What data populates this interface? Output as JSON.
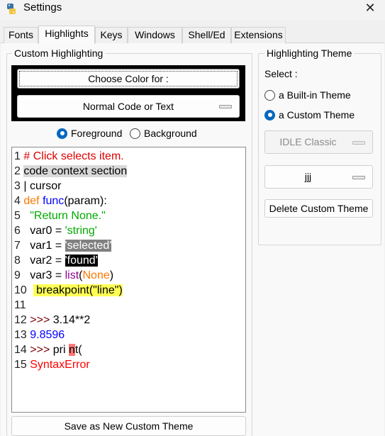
{
  "window": {
    "title": "Settings",
    "close_glyph": "✕"
  },
  "tabs": [
    {
      "label": "Fonts",
      "active": false
    },
    {
      "label": "Highlights",
      "active": true
    },
    {
      "label": "Keys",
      "active": false
    },
    {
      "label": "Windows",
      "active": false
    },
    {
      "label": "Shell/Ed",
      "active": false
    },
    {
      "label": "Extensions",
      "active": false
    }
  ],
  "custom": {
    "group_label": "Custom Highlighting",
    "choose_color_label": "Choose Color for :",
    "element_label": "Normal Code or Text",
    "foreground_label": "Foreground",
    "background_label": "Background",
    "target": "foreground",
    "save_label": "Save as New Custom Theme"
  },
  "sample": {
    "line_numbers": [
      "1",
      "2",
      "3",
      "4",
      "5",
      "6",
      "7",
      "8",
      "9",
      "10",
      "11",
      "12",
      "13",
      "14",
      "15"
    ],
    "comment": "# Click selects item.",
    "context": "code context section",
    "cursor_bar": "|",
    "cursor_text": " cursor",
    "kw_def": "def",
    "func_name": "func",
    "param": "(param):",
    "docstring": "\"Return None.\"",
    "var0": "var0 = ",
    "str_string": "'string'",
    "var1": "var1 = ",
    "str_selected": "'selected'",
    "var2": "var2 = ",
    "str_found": "'found'",
    "var3": "var3 = ",
    "builtin_list": "list",
    "paren_open": "(",
    "kw_none": "None",
    "paren_close": ")",
    "breakpoint": " breakpoint(\"line\")",
    "prompt": ">>>",
    "expr": " 3.14**2",
    "result": "9.8596",
    "pri": " pri ",
    "err_n": "n",
    "t_paren": "t(",
    "syntax_error": "SyntaxError"
  },
  "theme": {
    "group_label": "Highlighting Theme",
    "select_label": "Select :",
    "builtin_label": "a Built-in Theme",
    "custom_label": "a Custom Theme",
    "selected_kind": "custom",
    "builtin_name": "IDLE Classic",
    "custom_name": "jjj",
    "delete_label": "Delete Custom Theme"
  },
  "colors": {
    "accent": "#0067c0",
    "comment": "#dd0000",
    "keyword": "#ff7700",
    "definition": "#0000ff",
    "string": "#00aa00",
    "builtin": "#900090",
    "console": "#770000",
    "stdout": "#0000ff",
    "error_text": "#ff0000",
    "context_bg": "#d9d9d9",
    "selected_bg": "#808080",
    "found_bg": "#000000",
    "breakpoint_bg": "#ffff55",
    "error_bg": "#ff7777"
  }
}
